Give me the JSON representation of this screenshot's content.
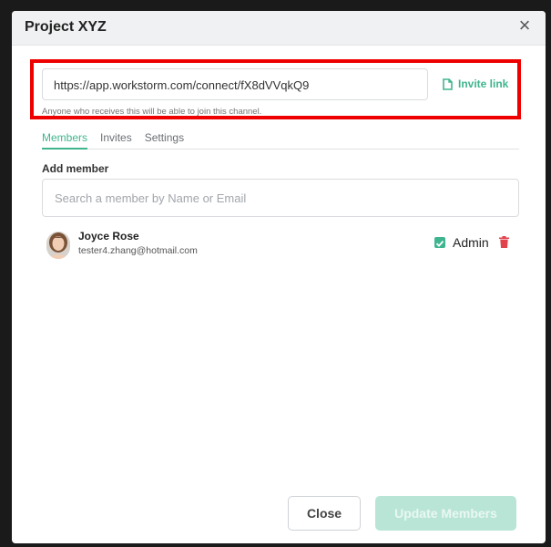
{
  "modal": {
    "title": "Project XYZ",
    "close_glyph": "×"
  },
  "invite": {
    "url": "https://app.workstorm.com/connect/fX8dVVqkQ9",
    "button_label": "Invite link",
    "hint": "Anyone who receives this will be able to join this channel.",
    "icon": "copy-icon"
  },
  "tabs": [
    {
      "label": "Members",
      "active": true
    },
    {
      "label": "Invites",
      "active": false
    },
    {
      "label": "Settings",
      "active": false
    }
  ],
  "add_member": {
    "label": "Add member",
    "placeholder": "Search a member by Name or Email",
    "value": ""
  },
  "members": [
    {
      "name": "Joyce Rose",
      "email": "tester4.zhang@hotmail.com",
      "admin_label": "Admin",
      "admin_checked": true
    }
  ],
  "footer": {
    "close_label": "Close",
    "update_label": "Update Members"
  },
  "colors": {
    "accent": "#3fb58f",
    "highlight": "#ee0000",
    "delete": "#e0434b",
    "disabled_button": "#b9e5d7"
  }
}
